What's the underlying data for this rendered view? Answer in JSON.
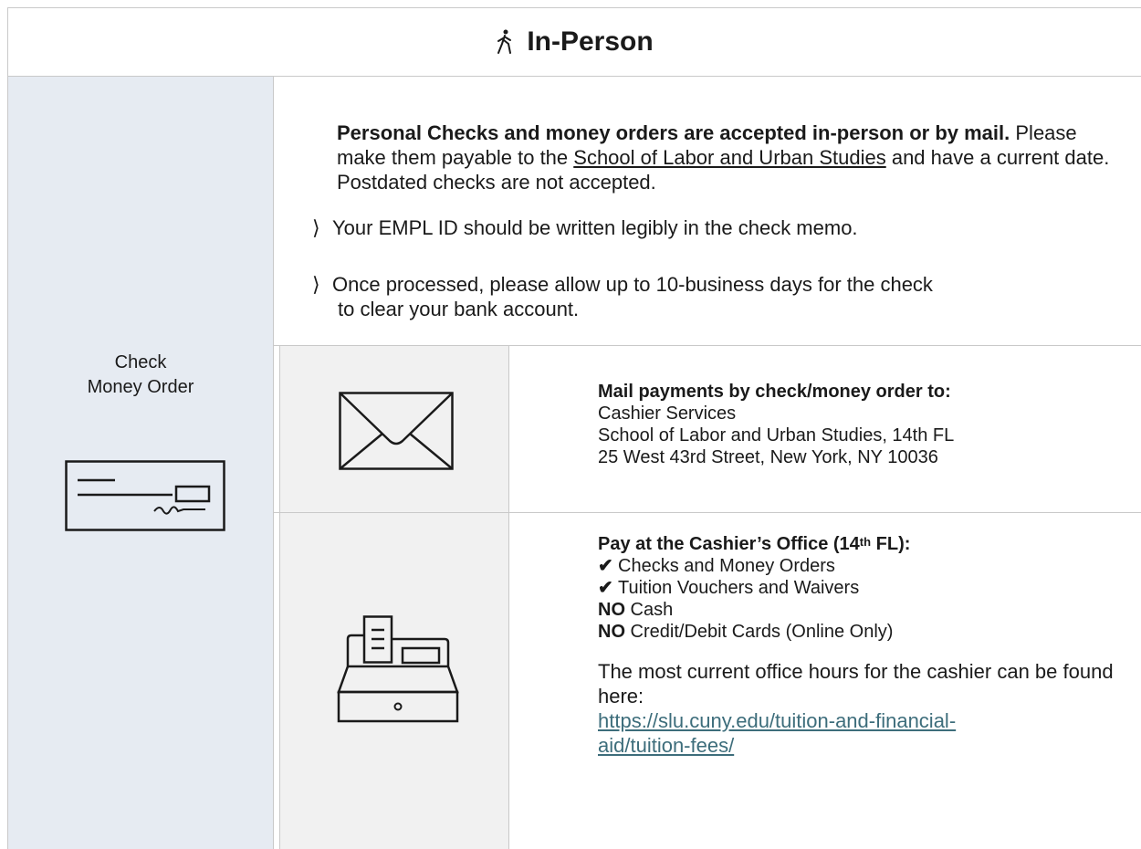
{
  "header": {
    "title": "In-Person",
    "icon": "walking-person-icon"
  },
  "left": {
    "line1": "Check",
    "line2": "Money Order",
    "icon": "check-icon"
  },
  "info": {
    "lead_bold": "Personal Checks and money orders are accepted in-person or by mail.",
    "lead_text_before": " Please make them payable to the ",
    "payee": "School of Labor and Urban Studies",
    "lead_text_after": " and have a current date. Postdated checks are not accepted.",
    "bullet_symbol": "⟩",
    "bullet1": "Your EMPL ID should be written legibly in the check memo.",
    "bullet2_line1": "Once processed, please allow up to 10-business days for the check",
    "bullet2_line2": "to clear your bank account."
  },
  "mail": {
    "icon": "envelope-icon",
    "heading": "Mail payments by check/money order to:",
    "line1": "Cashier Services",
    "line2": "School of Labor and Urban Studies, 14th FL",
    "line3": "25 West 43rd Street, New York, NY 10036"
  },
  "office": {
    "icon": "cash-register-icon",
    "heading_pre": "Pay at the Cashier’s Office (14",
    "heading_sup": "th",
    "heading_post": " FL):",
    "check_symbol": "✔",
    "item1": "Checks and Money Orders",
    "item2": "Tuition Vouchers and Waivers",
    "no_label": "NO",
    "no1": " Cash",
    "no2": " Credit/Debit Cards (Online Only)",
    "hours_text": "The most current office hours for the cashier can be found here:",
    "link_line1": "https://slu.cuny.edu/tuition-and-financial-",
    "link_line2": "aid/tuition-fees/"
  },
  "colors": {
    "left_bg": "#e6ebf2",
    "icon_cell_bg": "#f1f1f1",
    "link": "#3d6d7b"
  }
}
